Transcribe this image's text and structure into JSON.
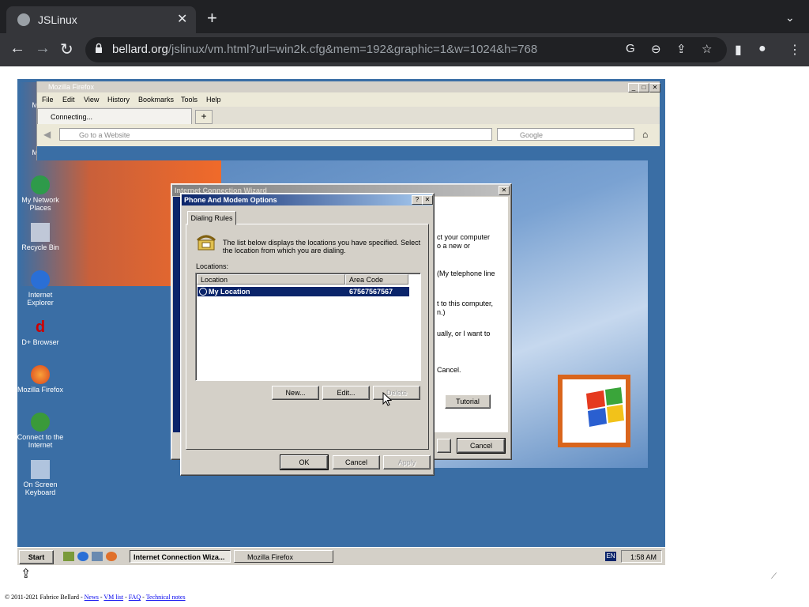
{
  "browser": {
    "tab_title": "JSLinux",
    "tab_close": "✕",
    "new_tab": "+",
    "url_domain": "bellard.org",
    "url_path": "/jslinux/vm.html?url=win2k.cfg&mem=192&graphic=1&w=1024&h=768"
  },
  "desktop_icons": [
    {
      "label": "My D"
    },
    {
      "label": "My C"
    },
    {
      "label": "My Network Places"
    },
    {
      "label": "Recycle Bin"
    },
    {
      "label": "Internet Explorer"
    },
    {
      "label": "D+ Browser"
    },
    {
      "label": "Mozilla Firefox"
    },
    {
      "label": "Connect to the Internet"
    },
    {
      "label": "On Screen Keyboard"
    }
  ],
  "firefox": {
    "title": "Mozilla Firefox",
    "menu": [
      "File",
      "Edit",
      "View",
      "History",
      "Bookmarks",
      "Tools",
      "Help"
    ],
    "tab_label": "Connecting...",
    "url_placeholder": "Go to a Website",
    "search_placeholder": "Google"
  },
  "icw": {
    "title": "Internet Connection Wizard",
    "text_lines": [
      "ct your computer",
      "o a new or",
      "(My telephone line",
      "t to this computer,",
      "n.)",
      "ually, or I want to",
      "Cancel."
    ],
    "tutorial": "Tutorial",
    "cancel": "Cancel"
  },
  "phone_modem": {
    "title": "Phone And Modem Options",
    "help": "?",
    "close": "✕",
    "tab": "Dialing Rules",
    "description": "The list below displays the locations you have specified. Select the location from which you are dialing.",
    "locations_label": "Locations:",
    "col_location": "Location",
    "col_area_code": "Area Code",
    "row_location": "My Location",
    "row_area_code": "67567567567",
    "new": "New...",
    "edit": "Edit...",
    "delete": "Delete",
    "ok": "OK",
    "cancel": "Cancel",
    "apply": "Apply"
  },
  "taskbar": {
    "start": "Start",
    "task1": "Internet Connection Wiza...",
    "task2": "Mozilla Firefox",
    "lang": "EN",
    "clock": "1:58 AM"
  },
  "footer": {
    "copyright": "© 2011-2021 Fabrice Bellard - ",
    "news": "News",
    "vmlist": "VM list",
    "faq": "FAQ",
    "tech": "Technical notes",
    "sep": " - "
  }
}
